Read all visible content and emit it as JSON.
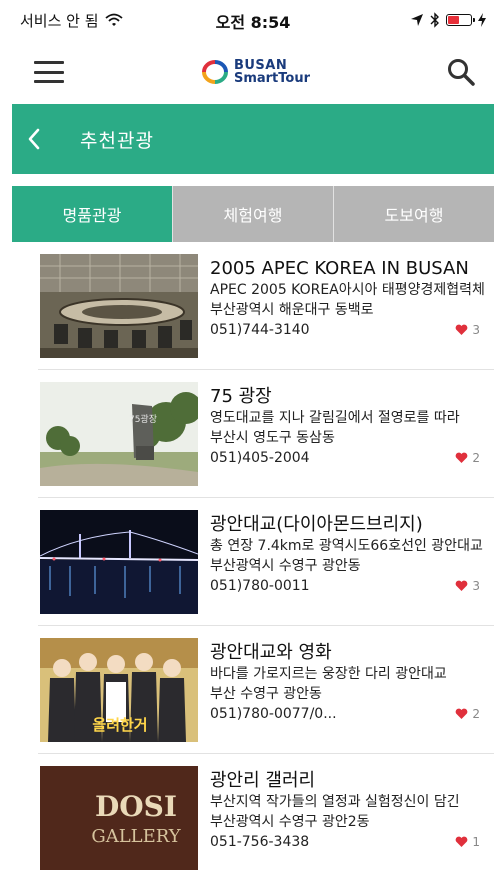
{
  "status": {
    "carrier": "서비스 안 됨",
    "time": "오전 8:54"
  },
  "header": {
    "logo_line1": "BUSAN",
    "logo_line2": "SmartTour"
  },
  "section": {
    "title": "추천관광"
  },
  "tabs": [
    {
      "label": "명품관광"
    },
    {
      "label": "체험여행"
    },
    {
      "label": "도보여행"
    }
  ],
  "items": [
    {
      "title": "2005 APEC KOREA IN BUSAN",
      "desc": "APEC 2005 KOREA아시아 태평양경제협력체",
      "addr": "부산광역시 해운대구 동백로",
      "tel": "051)744-3140",
      "likes": "3"
    },
    {
      "title": "75 광장",
      "desc": "영도대교를 지나 갈림길에서 절영로를 따라",
      "addr": "부산시 영도구 동삼동",
      "tel": "051)405-2004",
      "likes": "2"
    },
    {
      "title": "광안대교(다이아몬드브리지)",
      "desc": "총 연장 7.4km로 광역시도66호선인 광안대교",
      "addr": "부산광역시 수영구 광안동",
      "tel": "051)780-0011",
      "likes": "3"
    },
    {
      "title": "광안대교와 영화",
      "desc": "바다를 가로지르는 웅장한 다리 광안대교",
      "addr": "부산 수영구 광안동",
      "tel": "051)780-0077/0...",
      "likes": "2"
    },
    {
      "title": "광안리 갤러리",
      "desc": "부산지역 작가들의 열정과 실험정신이 담긴",
      "addr": "부산광역시 수영구 광안2동",
      "tel": "051-756-3438",
      "likes": "1"
    }
  ],
  "thumb_text": {
    "sign_75": "75광장",
    "gallery_1": "DOSI",
    "gallery_2": "GALLERY",
    "poster": "올려한거"
  },
  "colors": {
    "accent": "#2bab86",
    "tab_inactive": "#b5b5b5",
    "heart": "#e0303c"
  }
}
